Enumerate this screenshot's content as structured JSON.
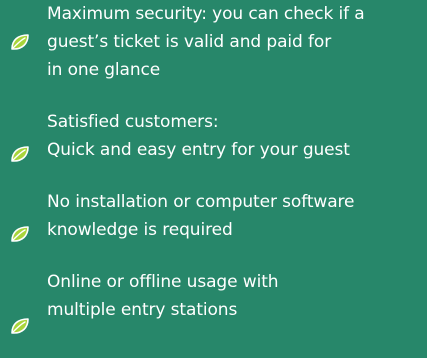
{
  "colors": {
    "background": "#27876a",
    "text": "#ffffff",
    "icon_fill": "#a9d53b",
    "icon_stroke": "#ffffff"
  },
  "features": [
    {
      "icon": "leaf-icon",
      "lines": [
        "Maximum security: you can check if a",
        "guest’s ticket is valid and paid for",
        "in one glance"
      ]
    },
    {
      "icon": "leaf-icon",
      "lines": [
        "Satisfied customers:",
        "Quick and easy entry for your guest"
      ]
    },
    {
      "icon": "leaf-icon",
      "lines": [
        "No installation or computer software",
        "knowledge is required"
      ]
    },
    {
      "icon": "leaf-icon",
      "lines": [
        "Online or offline usage with",
        "multiple entry stations"
      ]
    }
  ]
}
